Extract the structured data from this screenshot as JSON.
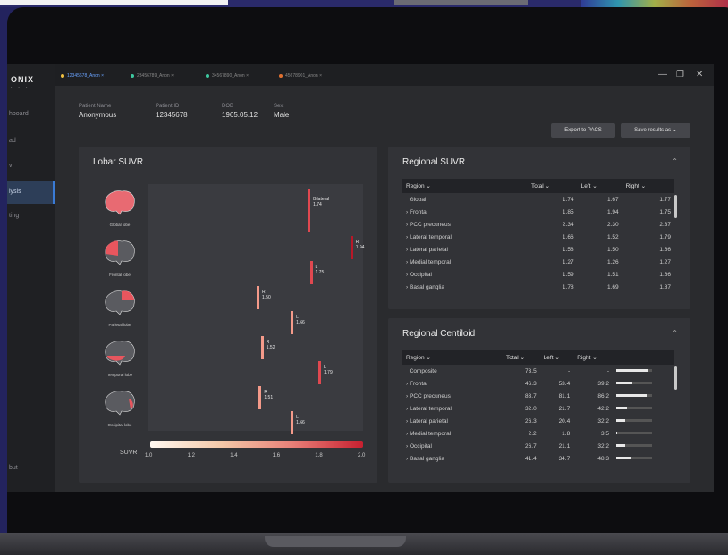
{
  "app": {
    "logo": "ONIX"
  },
  "sidebar": {
    "items": [
      {
        "label": "hboard"
      },
      {
        "label": "ad"
      },
      {
        "label": "v"
      },
      {
        "label": "lysis",
        "active": true
      },
      {
        "label": "ting"
      },
      {
        "label": "but"
      }
    ]
  },
  "tabs": [
    {
      "label": "12345678_Anon",
      "color": "#f0c040",
      "active": true
    },
    {
      "label": "23456789_Anon",
      "color": "#3ec8a0"
    },
    {
      "label": "34567890_Anon",
      "color": "#3ec8a0"
    },
    {
      "label": "45678901_Anon",
      "color": "#e07030"
    }
  ],
  "patient": {
    "name_label": "Patient Name",
    "name": "Anonymous",
    "id_label": "Patient ID",
    "id": "12345678",
    "dob_label": "DOB",
    "dob": "1965.05.12",
    "sex_label": "Sex",
    "sex": "Male"
  },
  "buttons": {
    "export": "Export to PACS",
    "save": "Save results as"
  },
  "lobar": {
    "title": "Lobar SUVR",
    "scale_title": "SUVR",
    "scale_ticks": [
      "1.0",
      "1.2",
      "1.4",
      "1.6",
      "1.8",
      "2.0"
    ],
    "rows": [
      {
        "label": "Global lobe",
        "markers": [
          {
            "side": "Bilateral",
            "value": "1.74",
            "suvr": 1.74
          }
        ]
      },
      {
        "label": "Frontal lobe",
        "markers": [
          {
            "side": "R",
            "value": "1.94",
            "suvr": 1.94
          },
          {
            "side": "L",
            "value": "1.75",
            "suvr": 1.75
          }
        ]
      },
      {
        "label": "Parietal lobe",
        "markers": [
          {
            "side": "R",
            "value": "1.50",
            "suvr": 1.5
          },
          {
            "side": "L",
            "value": "1.66",
            "suvr": 1.66
          }
        ]
      },
      {
        "label": "Temporal lobe",
        "markers": [
          {
            "side": "R",
            "value": "1.52",
            "suvr": 1.52
          },
          {
            "side": "L",
            "value": "1.79",
            "suvr": 1.79
          }
        ]
      },
      {
        "label": "Occipital lobe",
        "markers": [
          {
            "side": "R",
            "value": "1.51",
            "suvr": 1.51
          },
          {
            "side": "L",
            "value": "1.66",
            "suvr": 1.66
          }
        ]
      }
    ]
  },
  "regional_suvr": {
    "title": "Regional SUVR",
    "headers": [
      "Region",
      "Total",
      "Left",
      "Right"
    ],
    "rows": [
      [
        "Global",
        "1.74",
        "1.67",
        "1.77"
      ],
      [
        "Frontal",
        "1.85",
        "1.94",
        "1.75"
      ],
      [
        "PCC precuneus",
        "2.34",
        "2.30",
        "2.37"
      ],
      [
        "Lateral temporal",
        "1.66",
        "1.52",
        "1.79"
      ],
      [
        "Lateral parietal",
        "1.58",
        "1.50",
        "1.66"
      ],
      [
        "Medial temporal",
        "1.27",
        "1.26",
        "1.27"
      ],
      [
        "Occipital",
        "1.59",
        "1.51",
        "1.66"
      ],
      [
        "Basal ganglia",
        "1.78",
        "1.69",
        "1.87"
      ]
    ]
  },
  "regional_centiloid": {
    "title": "Regional Centiloid",
    "headers": [
      "Region",
      "Total",
      "Left",
      "Right"
    ],
    "rows": [
      {
        "region": "Composite",
        "total": "73.5",
        "left": "-",
        "right": "-",
        "level": 0.9
      },
      {
        "region": "Frontal",
        "total": "46.3",
        "left": "53.4",
        "right": "39.2",
        "level": 0.45
      },
      {
        "region": "PCC precuneus",
        "total": "83.7",
        "left": "81.1",
        "right": "86.2",
        "level": 0.85
      },
      {
        "region": "Lateral temporal",
        "total": "32.0",
        "left": "21.7",
        "right": "42.2",
        "level": 0.3
      },
      {
        "region": "Lateral parietal",
        "total": "26.3",
        "left": "20.4",
        "right": "32.2",
        "level": 0.25
      },
      {
        "region": "Medial temporal",
        "total": "2.2",
        "left": "1.8",
        "right": "3.5",
        "level": 0.03
      },
      {
        "region": "Occipital",
        "total": "26.7",
        "left": "21.1",
        "right": "32.2",
        "level": 0.25
      },
      {
        "region": "Basal ganglia",
        "total": "41.4",
        "left": "34.7",
        "right": "48.3",
        "level": 0.4
      }
    ]
  }
}
